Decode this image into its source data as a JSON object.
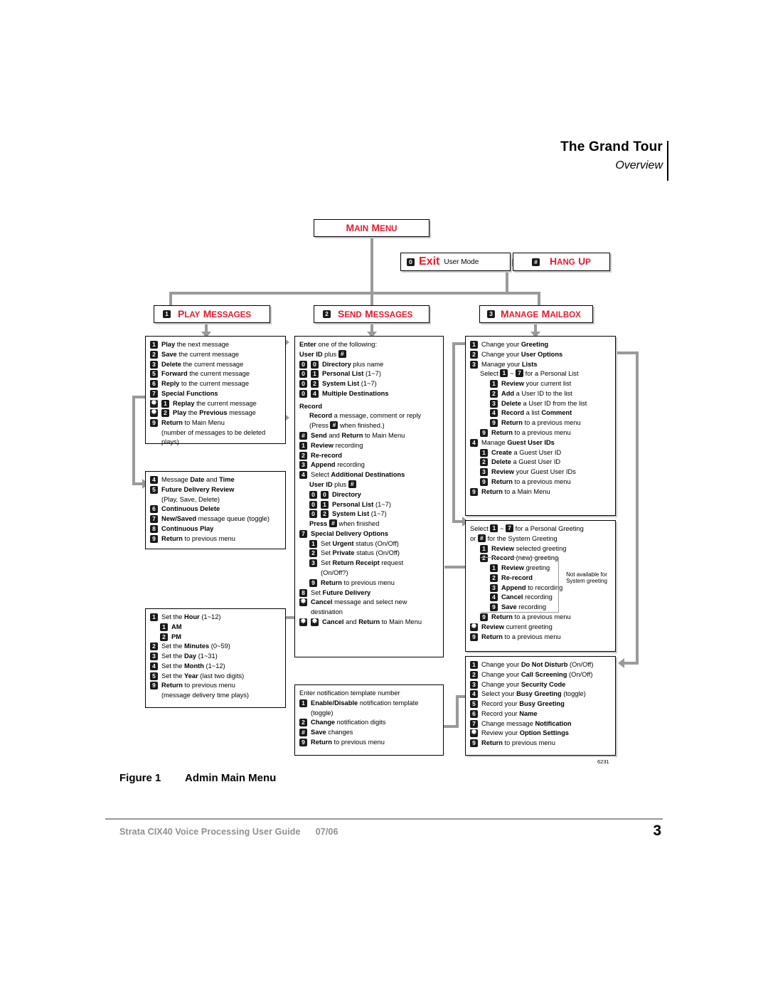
{
  "header": {
    "title": "The Grand Tour",
    "subtitle": "Overview"
  },
  "figure": {
    "id_number": "6231",
    "caption_label": "Figure 1",
    "caption_title": "Admin Main Menu"
  },
  "footer": {
    "text": "Strata CIX40 Voice Processing User Guide",
    "date": "07/06",
    "page": "3"
  },
  "nodes": {
    "main_menu": "Main Menu",
    "exit": {
      "key": "0",
      "label": "Exit",
      "sub": "User Mode"
    },
    "hangup": {
      "key": "#",
      "label": "Hang Up"
    },
    "play_messages": {
      "key": "1",
      "label": "Play Messages"
    },
    "send_messages": {
      "key": "2",
      "label": "Send Messages"
    },
    "manage_mailbox": {
      "key": "3",
      "label": "Manage Mailbox"
    }
  },
  "play_box": {
    "rows": [
      {
        "k": "1",
        "html": "<b>Play</b> the next message"
      },
      {
        "k": "2",
        "html": "<b>Save</b> the current message"
      },
      {
        "k": "3",
        "html": "<b>Delete</b> the current message"
      },
      {
        "k": "5",
        "html": "<b>Forward</b> the current message"
      },
      {
        "k": "6",
        "html": "<b>Reply</b> to the current message"
      },
      {
        "k": "7",
        "html": "<b>Special Functions</b>"
      },
      {
        "k": "*",
        "k2": "1",
        "html": "<b>Replay</b> the current message"
      },
      {
        "k": "*",
        "k2": "2",
        "html": "<b>Play</b> the <b>Previous</b> message"
      },
      {
        "k": "9",
        "html": "<b>Return</b> to  Main Menu"
      }
    ],
    "continuation": "(number of messages to be deleted plays)"
  },
  "play_sub_box": {
    "rows": [
      {
        "k": "4",
        "html": "Message <b>Date</b> and <b>Time</b>"
      },
      {
        "k": "5",
        "html": "<b>Future Delivery Review</b>"
      },
      {
        "k": "",
        "html": "(Play, Save, Delete)"
      },
      {
        "k": "6",
        "html": "<b>Continuous Delete</b>"
      },
      {
        "k": "7",
        "html": "<b>New/Saved</b> message queue (toggle)"
      },
      {
        "k": "8",
        "html": "<b>Continuous Play</b>"
      },
      {
        "k": "9",
        "html": "<b>Return</b> to previous menu"
      }
    ]
  },
  "time_box": {
    "rows": [
      {
        "k": "1",
        "html": "Set the <b>Hour</b> (1~12)"
      },
      {
        "k": "1",
        "ind": 1,
        "html": "<b>AM</b>"
      },
      {
        "k": "2",
        "ind": 1,
        "html": "<b>PM</b>"
      },
      {
        "k": "2",
        "html": "Set the <b>Minutes</b> (0~59)"
      },
      {
        "k": "3",
        "html": "Set the <b>Day</b> (1~31)"
      },
      {
        "k": "4",
        "html": "Set the <b>Month</b> (1~12)"
      },
      {
        "k": "5",
        "html": "Set the <b>Year</b> (last two digits)"
      },
      {
        "k": "9",
        "html": "<b>Return</b> to previous menu"
      }
    ],
    "continuation": "(message delivery time plays)"
  },
  "send_box": {
    "intro": "<b>Enter</b> one of the following:",
    "userid": "<b>User ID</b> plus",
    "dest_rows": [
      {
        "k": "0",
        "k2": "0",
        "html": "<b>Directory</b> plus name"
      },
      {
        "k": "0",
        "k2": "1",
        "html": "<b>Personal List</b> (1~7)"
      },
      {
        "k": "0",
        "k2": "2",
        "html": "<b>System List</b> (1~7)"
      },
      {
        "k": "0",
        "k2": "4",
        "html": "<b>Multiple Destinations</b>"
      }
    ],
    "record_head": "<b>Record</b>",
    "record_desc1": "<b>Record</b> a message, comment or reply",
    "record_desc2a": "(Press",
    "record_desc2b": "when finished.)",
    "rows": [
      {
        "k": "#",
        "html": "<b>Send</b> and <b>Return</b> to Main Menu"
      },
      {
        "k": "1",
        "html": "<b>Review</b> recording"
      },
      {
        "k": "2",
        "html": "<b>Re-record</b>"
      },
      {
        "k": "3",
        "html": "<b>Append</b> recording"
      },
      {
        "k": "4",
        "html": "Select <b>Additional Destinations</b>"
      }
    ],
    "userid2": "<b>User ID</b> plus",
    "dest2_rows": [
      {
        "k": "0",
        "k2": "0",
        "html": "<b>Directory</b>"
      },
      {
        "k": "0",
        "k2": "1",
        "html": "<b>Personal List</b> (1~7)"
      },
      {
        "k": "0",
        "k2": "2",
        "html": "<b>System List</b> (1~7)"
      }
    ],
    "press_a": "<b>Press</b>",
    "press_b": "when finished",
    "sdo": "<b>Special Delivery Options</b>",
    "sdo_key": "7",
    "sdo_rows": [
      {
        "k": "1",
        "html": "Set <b>Urgent</b> status (On/Off)"
      },
      {
        "k": "2",
        "html": "Set <b>Private</b> status (On/Off)"
      },
      {
        "k": "3",
        "html": "Set <b>Return Receipt</b> request"
      },
      {
        "k": "",
        "html": "(On/Off?)"
      },
      {
        "k": "9",
        "html": "<b>Return</b> to previous menu"
      }
    ],
    "tail_rows": [
      {
        "k": "8",
        "html": "Set <b>Future Delivery</b>"
      },
      {
        "k": "*",
        "html": "<b>Cancel</b> message and select new"
      },
      {
        "k": "",
        "html": "destination"
      },
      {
        "k": "*",
        "k2": "*",
        "html": "<b>Cancel</b> and <b>Return</b> to Main Menu"
      }
    ]
  },
  "notify_box": {
    "intro": "Enter notification template number",
    "rows": [
      {
        "k": "1",
        "html": "<b>Enable/Disable</b> notification template"
      },
      {
        "k": "",
        "html": "(toggle)"
      },
      {
        "k": "2",
        "html": "<b>Change</b> notification digits"
      },
      {
        "k": "#",
        "html": "<b>Save</b> changes"
      },
      {
        "k": "9",
        "html": "<b>Return</b> to previous menu"
      }
    ]
  },
  "mailbox_box": {
    "rows": [
      {
        "k": "1",
        "html": "Change your <b>Greeting</b>"
      },
      {
        "k": "2",
        "html": "Change your <b>User Options</b>"
      },
      {
        "k": "3",
        "html": "Manage your <b>Lists</b>"
      }
    ],
    "select_a": "Select",
    "select_mid": "~",
    "select_b": "for a Personal List",
    "select_k1": "1",
    "select_k2": "7",
    "list_rows": [
      {
        "k": "1",
        "html": "<b>Review</b> your current list"
      },
      {
        "k": "2",
        "html": "<b>Add</b> a User ID to the list"
      },
      {
        "k": "3",
        "html": "<b>Delete</b> a User ID from the list"
      },
      {
        "k": "4",
        "html": "<b>Record</b> a list <b>Comment</b>"
      },
      {
        "k": "9",
        "html": "<b>Return</b> to a previous menu"
      }
    ],
    "return_row": {
      "k": "9",
      "html": "<b>Return</b> to a previous menu"
    },
    "guest_row": {
      "k": "4",
      "html": "Manage <b>Guest User IDs</b>"
    },
    "guest_rows": [
      {
        "k": "1",
        "html": "<b>Create</b> a Guest User ID"
      },
      {
        "k": "2",
        "html": "<b>Delete</b> a Guest User ID"
      },
      {
        "k": "3",
        "html": "<b>Review</b> your Guest User IDs"
      },
      {
        "k": "9",
        "html": "<b>Return</b> to a previous menu"
      }
    ],
    "final_row": {
      "k": "9",
      "html": "<b>Return</b> to a Main Menu"
    }
  },
  "greeting_box": {
    "select_a": "Select",
    "select_mid": "~",
    "select_b": "for a Personal Greeting",
    "select_k1": "1",
    "select_k2": "7",
    "or_a": "or",
    "or_b": "for the System Greeting",
    "or_key": "#",
    "rows": [
      {
        "k": "1",
        "html": "<b>Review</b> selected greeting"
      },
      {
        "k": "2",
        "html": "<b>Record</b> (new) greeting"
      }
    ],
    "inner_rows": [
      {
        "k": "1",
        "html": "<b>Review</b> greeting"
      },
      {
        "k": "2",
        "html": "<b>Re-record</b>"
      },
      {
        "k": "3",
        "html": "<b>Append</b> to recording"
      },
      {
        "k": "4",
        "html": "<b>Cancel</b> recording"
      },
      {
        "k": "9",
        "html": "<b>Save</b> recording"
      }
    ],
    "note": "Not available for System greeting",
    "after_rows": [
      {
        "k": "9",
        "ind": 1,
        "html": "<b>Return</b> to a previous menu"
      },
      {
        "k": "*",
        "html": "<b>Review</b> current greeting"
      },
      {
        "k": "9",
        "html": "<b>Return</b> to a previous menu"
      }
    ]
  },
  "options_box": {
    "rows": [
      {
        "k": "1",
        "html": "Change your <b>Do Not Disturb</b> (On/Off)"
      },
      {
        "k": "2",
        "html": "Change your <b>Call Screening</b> (On/Off)"
      },
      {
        "k": "3",
        "html": "Change your <b>Security Code</b>"
      },
      {
        "k": "4",
        "html": "Select your <b>Busy Greeting</b> (toggle)"
      },
      {
        "k": "5",
        "html": "Record your <b>Busy Greeting</b>"
      },
      {
        "k": "6",
        "html": "Record your <b>Name</b>"
      },
      {
        "k": "7",
        "html": "Change message <b>Notification</b>"
      },
      {
        "k": "*",
        "html": "Review your <b>Option Settings</b>"
      },
      {
        "k": "9",
        "html": "<b>Return</b> to previous menu"
      }
    ]
  }
}
